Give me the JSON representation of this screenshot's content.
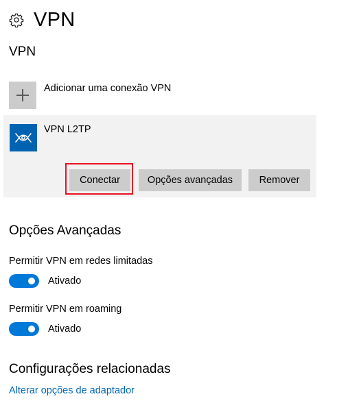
{
  "header": {
    "icon": "gear-icon",
    "title": "VPN"
  },
  "vpn_section": {
    "title": "VPN",
    "add_connection": {
      "icon": "plus-icon",
      "label": "Adicionar uma conexão VPN"
    },
    "connection": {
      "icon": "vpn-icon",
      "name": "VPN L2TP",
      "buttons": {
        "connect": "Conectar",
        "advanced": "Opções avançadas",
        "remove": "Remover"
      }
    }
  },
  "advanced_options": {
    "title": "Opções Avançadas",
    "options": [
      {
        "label": "Permitir VPN em redes limitadas",
        "state": "Ativado",
        "on": true
      },
      {
        "label": "Permitir VPN em roaming",
        "state": "Ativado",
        "on": true
      }
    ]
  },
  "related": {
    "title": "Configurações relacionadas",
    "link": "Alterar opções de adaptador"
  },
  "colors": {
    "accent": "#0078d7",
    "link": "#0066b4",
    "highlight": "#e81123",
    "card_bg": "#f2f2f2",
    "button_bg": "#cccccc"
  }
}
